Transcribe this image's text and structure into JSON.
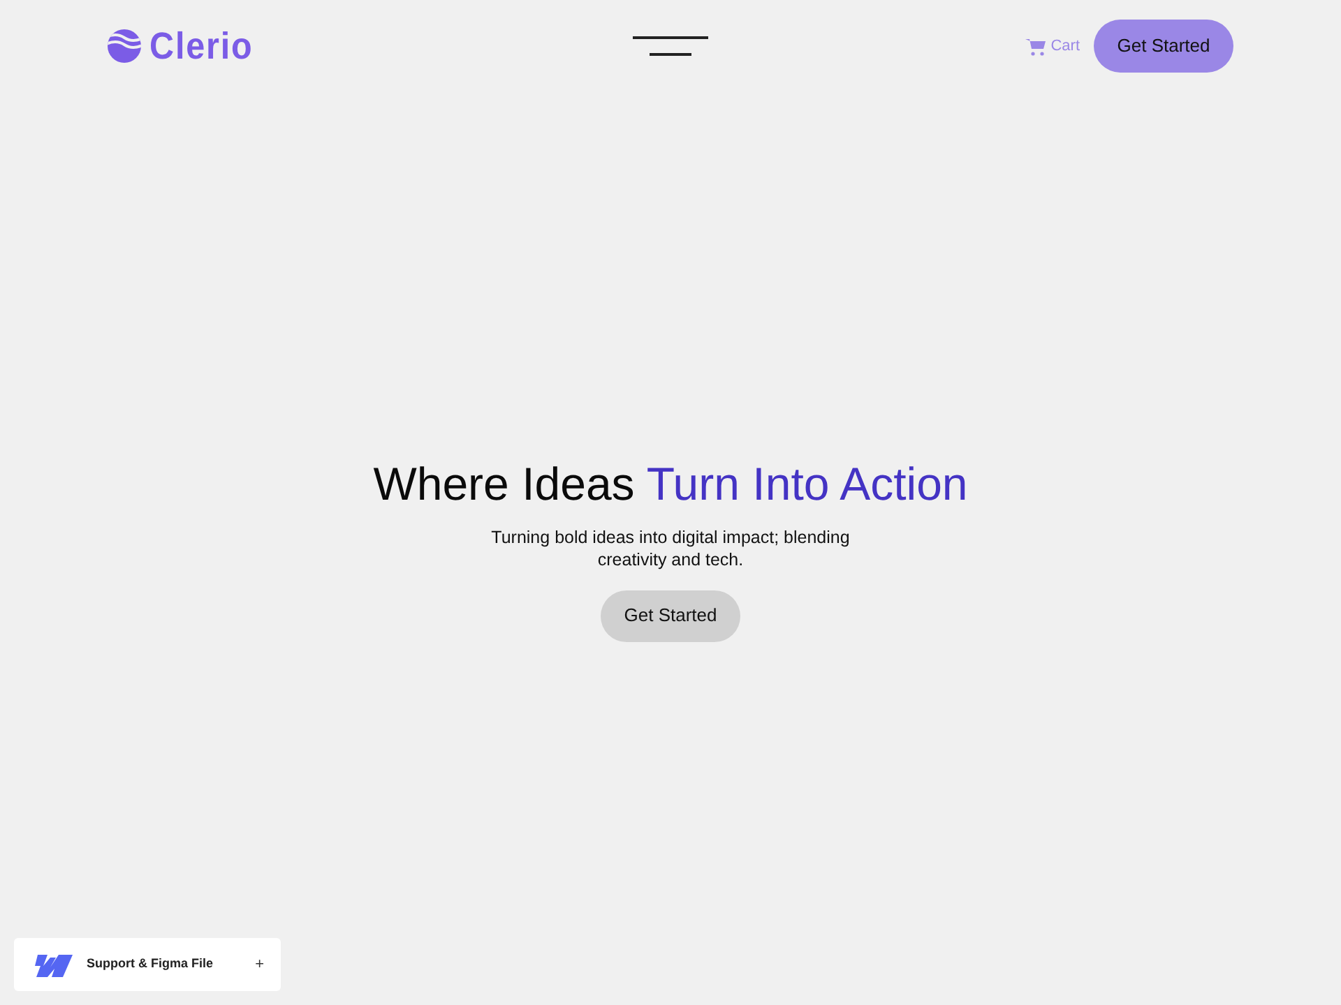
{
  "header": {
    "logo": {
      "text": "Clerio"
    },
    "cart": {
      "label": "Cart"
    },
    "cta": {
      "label": "Get Started"
    }
  },
  "hero": {
    "heading": {
      "plain": "Where Ideas",
      "accent": "Turn Into Action"
    },
    "subtitle": "Turning bold ideas into digital impact; blending creativity and tech.",
    "button": {
      "label": "Get Started"
    }
  },
  "widget": {
    "label": "Support & Figma File",
    "toggle": "+"
  }
}
